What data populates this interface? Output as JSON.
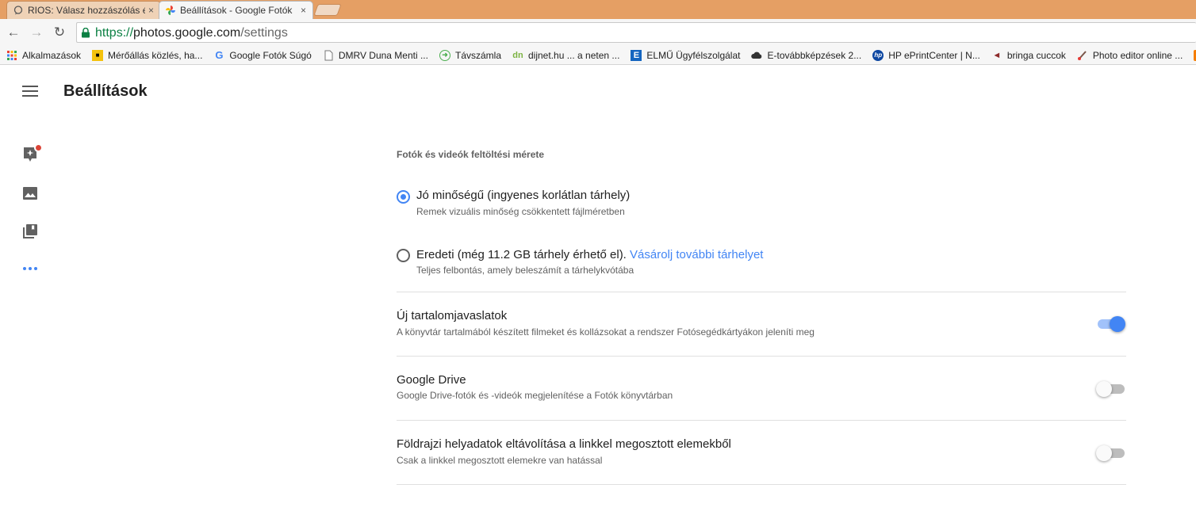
{
  "browser": {
    "tabs": [
      {
        "label": "RIOS: Válasz hozzászólás é",
        "close": "×",
        "icon": "chat-bubble-icon",
        "active": false
      },
      {
        "label": "Beállítások - Google Fotók",
        "close": "×",
        "icon": "google-photos-icon",
        "active": true
      }
    ],
    "url": {
      "scheme": "https://",
      "host": "photos.google.com",
      "path": "/settings"
    },
    "bookmarks": [
      {
        "label": "Alkalmazások",
        "icon": "apps-grid-icon"
      },
      {
        "label": "Mérőállás közlés, ha...",
        "icon": "meter-icon"
      },
      {
        "label": "Google Fotók Súgó",
        "icon": "google-g-icon"
      },
      {
        "label": "DMRV Duna Menti ...",
        "icon": "page-icon"
      },
      {
        "label": "Távszámla",
        "icon": "green-arrow-icon"
      },
      {
        "label": "dijnet.hu ... a neten ...",
        "icon": "dijnet-icon"
      },
      {
        "label": "ELMŰ Ügyfélszolgálat",
        "icon": "elmu-icon"
      },
      {
        "label": "E-továbbképzések 2...",
        "icon": "cloud-icon"
      },
      {
        "label": "HP ePrintCenter | N...",
        "icon": "hp-icon"
      },
      {
        "label": "bringa cuccok",
        "icon": "bike-icon"
      },
      {
        "label": "Photo editor online ...",
        "icon": "brush-icon"
      }
    ]
  },
  "header": {
    "title": "Beállítások"
  },
  "settings": {
    "upload_heading": "Fotók és videók feltöltési mérete",
    "options": [
      {
        "title": "Jó minőségű (ingyenes korlátlan tárhely)",
        "link": "",
        "subtitle": "Remek vizuális minőség csökkentett fájlméretben",
        "checked": true
      },
      {
        "title": "Eredeti (még 11.2 GB tárhely érhető el).",
        "link": "Vásárolj további tárhelyet",
        "subtitle": "Teljes felbontás, amely beleszámít a tárhelykvótába",
        "checked": false
      }
    ],
    "toggles": [
      {
        "title": "Új tartalomjavaslatok",
        "subtitle": "A könyvtár tartalmából készített filmeket és kollázsokat a rendszer Fotósegédkártyákon jeleníti meg",
        "on": true
      },
      {
        "title": "Google Drive",
        "subtitle": "Google Drive-fotók és -videók megjelenítése a Fotók könyvtárban",
        "on": false
      },
      {
        "title": "Földrajzi helyadatok eltávolítása a linkkel megosztott elemekből",
        "subtitle": "Csak a linkkel megosztott elemekre van hatással",
        "on": false
      }
    ]
  },
  "colors": {
    "accent": "#4285f4",
    "badge": "#db4437",
    "tabstrip": "#e59f64"
  }
}
